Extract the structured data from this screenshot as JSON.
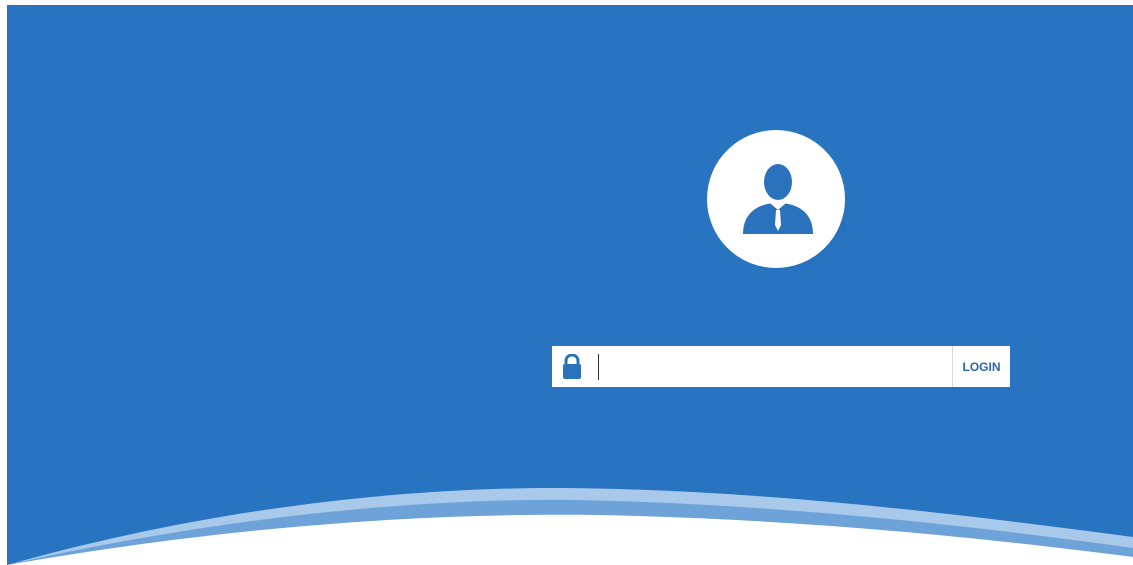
{
  "login": {
    "password_value": "",
    "password_placeholder": "",
    "login_label": "LOGIN"
  },
  "icons": {
    "avatar": "user-avatar-icon",
    "lock": "lock-icon"
  },
  "colors": {
    "background": "#2874c1",
    "accent_text": "#2b66aa",
    "wave_light": "#a9c9ea",
    "wave_mid": "#6ea3da",
    "surface": "#ffffff"
  }
}
